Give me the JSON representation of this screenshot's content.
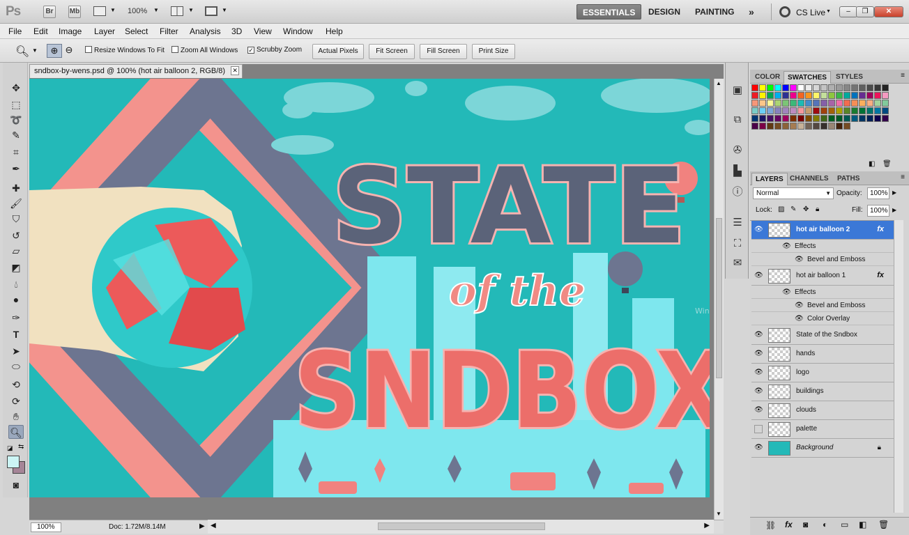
{
  "app": {
    "logo": "Ps",
    "bridge_label": "Br",
    "minibridge_label": "Mb",
    "zoom_display": "100%",
    "workspaces": [
      "ESSENTIALS",
      "DESIGN",
      "PAINTING"
    ],
    "more_workspaces": "»",
    "cs_live": "CS Live",
    "window_controls": [
      "–",
      "❐",
      "✕"
    ]
  },
  "menu": [
    "File",
    "Edit",
    "Image",
    "Layer",
    "Select",
    "Filter",
    "Analysis",
    "3D",
    "View",
    "Window",
    "Help"
  ],
  "options": {
    "resize_windows": "Resize Windows To Fit",
    "zoom_all": "Zoom All Windows",
    "scrubby_zoom": "Scrubby Zoom",
    "buttons": [
      "Actual Pixels",
      "Fit Screen",
      "Fill Screen",
      "Print Size"
    ]
  },
  "document": {
    "tab_title": "sndbox-by-wens.psd @ 100% (hot air balloon 2, RGB/8)",
    "close": "✕",
    "artwork_title_line1": "STATE",
    "artwork_title_line2": "of the",
    "artwork_title_line3": "SNDBOX",
    "watermark": "Window Snip"
  },
  "status": {
    "zoom": "100%",
    "doc_info": "Doc: 1.72M/8.14M"
  },
  "swatch_panel": {
    "tabs": [
      "COLOR",
      "SWATCHES",
      "STYLES"
    ],
    "colors": [
      "#ff0000",
      "#ffff00",
      "#00ff00",
      "#00ffff",
      "#0000ff",
      "#ff00ff",
      "#ffffff",
      "#ebebeb",
      "#d7d7d7",
      "#c3c3c3",
      "#afafaf",
      "#9b9b9b",
      "#878787",
      "#737373",
      "#5f5f5f",
      "#4b4b4b",
      "#373737",
      "#232323",
      "#ed1c24",
      "#fff200",
      "#00a651",
      "#00aeef",
      "#2e3192",
      "#ec008c",
      "#f26522",
      "#f7941d",
      "#fff568",
      "#c4df9b",
      "#8dc63f",
      "#39b54a",
      "#00a99d",
      "#0072bc",
      "#662d91",
      "#9e005d",
      "#ed145b",
      "#f49ac1",
      "#f69679",
      "#fdc689",
      "#fff799",
      "#acd373",
      "#7cc576",
      "#3cb878",
      "#1cbbb4",
      "#448ccb",
      "#5674b9",
      "#855fa8",
      "#a864a8",
      "#f06eaa",
      "#f26c4f",
      "#f68e56",
      "#fbaf5d",
      "#f9ad81",
      "#a3d39c",
      "#82ca9c",
      "#7accc8",
      "#6dcff6",
      "#7da7d9",
      "#8781bd",
      "#a186be",
      "#bd8cbf",
      "#f5989d",
      "#c69c6d",
      "#9e0b0f",
      "#a0410d",
      "#a36209",
      "#aba000",
      "#598527",
      "#1a7b30",
      "#007236",
      "#00746b",
      "#0076a3",
      "#004a80",
      "#003471",
      "#1b1464",
      "#440e62",
      "#630460",
      "#9e005d",
      "#7b2e00",
      "#790000",
      "#7d4900",
      "#827b00",
      "#406618",
      "#005e20",
      "#005826",
      "#005952",
      "#005b7f",
      "#003663",
      "#002157",
      "#0d004c",
      "#32004b",
      "#4b0049",
      "#7b0046",
      "#603913",
      "#754c24",
      "#8c6239",
      "#a67c52",
      "#c7b299",
      "#736357",
      "#534741",
      "#362f2d",
      "#998675",
      "#42210b",
      "#754c24"
    ]
  },
  "layers_panel": {
    "tabs": [
      "LAYERS",
      "CHANNELS",
      "PATHS"
    ],
    "blend_mode": "Normal",
    "opacity_label": "Opacity:",
    "opacity": "100%",
    "lock_label": "Lock:",
    "fill_label": "Fill:",
    "fill": "100%",
    "effects_label": "Effects",
    "layers": [
      {
        "name": "hot air balloon 2",
        "fx": "fx",
        "effects": [
          "Bevel and Emboss"
        ]
      },
      {
        "name": "hot air balloon 1",
        "fx": "fx",
        "effects": [
          "Bevel and Emboss",
          "Color Overlay"
        ]
      },
      {
        "name": "State of the Sndbox"
      },
      {
        "name": "hands"
      },
      {
        "name": "logo"
      },
      {
        "name": "buildings"
      },
      {
        "name": "clouds"
      },
      {
        "name": "palette"
      },
      {
        "name": "Background"
      }
    ]
  }
}
